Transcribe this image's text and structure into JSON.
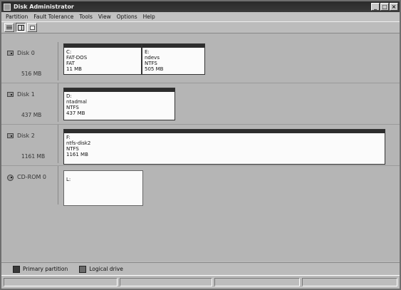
{
  "window": {
    "title": "Disk Administrator",
    "controls": [
      "_",
      "□",
      "×"
    ]
  },
  "menu": [
    "Partition",
    "Fault Tolerance",
    "Tools",
    "View",
    "Options",
    "Help"
  ],
  "toolbar": {
    "icons": [
      "disk-view-icon",
      "volume-view-icon",
      "properties-icon"
    ]
  },
  "disks": [
    {
      "name": "Disk 0",
      "size": "516 MB",
      "partitions": [
        {
          "drive": "C:",
          "label": "FAT-DOS",
          "fs": "FAT",
          "size": "11 MB"
        },
        {
          "drive": "E:",
          "label": "ndevs",
          "fs": "NTFS",
          "size": "505 MB"
        }
      ]
    },
    {
      "name": "Disk 1",
      "size": "437 MB",
      "partitions": [
        {
          "drive": "D:",
          "label": "ntadmal",
          "fs": "NTFS",
          "size": "437 MB"
        }
      ]
    },
    {
      "name": "Disk 2",
      "size": "1161 MB",
      "partitions": [
        {
          "drive": "F:",
          "label": "ntfs-disk2",
          "fs": "NTFS",
          "size": "1161 MB"
        }
      ]
    },
    {
      "name": "CD-ROM 0",
      "size": "",
      "partitions": [
        {
          "drive": "L:",
          "label": "",
          "fs": "",
          "size": ""
        }
      ]
    }
  ],
  "legend": {
    "primary": "Primary partition",
    "logical": "Logical drive"
  },
  "colors": {
    "partition_bar": "#2d2d2d",
    "partition_bg": "#fbfbfb",
    "window_bg": "#bdbdbd"
  }
}
